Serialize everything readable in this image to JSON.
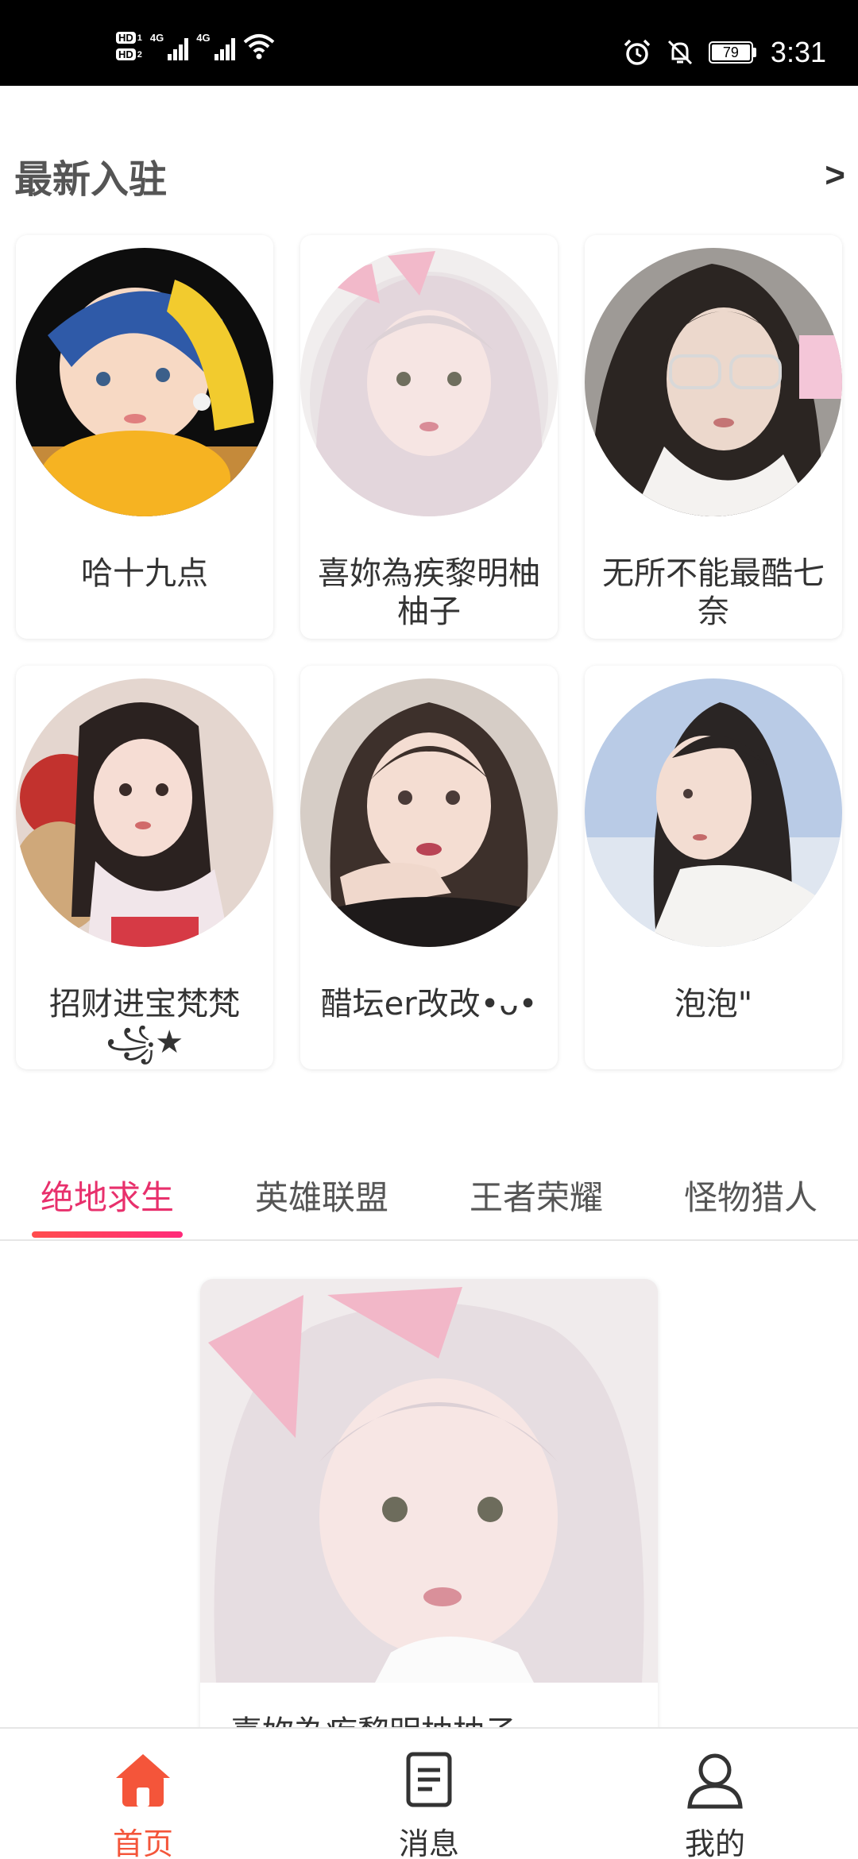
{
  "status_bar": {
    "hd1": "HD",
    "hd1_sub": "1",
    "hd2": "HD",
    "hd2_sub": "2",
    "net1": "4G",
    "net2": "4G",
    "battery": "79",
    "time": "3:31",
    "icons": [
      "signal-icon",
      "wifi-icon",
      "alarm-icon",
      "mute-icon",
      "battery-icon"
    ]
  },
  "section": {
    "title": "最新入驻",
    "more": ">"
  },
  "creators": [
    {
      "name": "哈十九点",
      "avatar": "avatar-icon"
    },
    {
      "name": "喜妳為疾黎明柚柚子",
      "avatar": "avatar-icon"
    },
    {
      "name": "无所不能最酷七奈",
      "avatar": "avatar-icon"
    },
    {
      "name": "招财进宝梵梵꧁★",
      "avatar": "avatar-icon"
    },
    {
      "name": "醋坛er改改•ᴗ•",
      "avatar": "avatar-icon"
    },
    {
      "name": "泡泡\"",
      "avatar": "avatar-icon"
    }
  ],
  "tabs": [
    {
      "label": "绝地求生",
      "active": true
    },
    {
      "label": "英雄联盟",
      "active": false
    },
    {
      "label": "王者荣耀",
      "active": false
    },
    {
      "label": "怪物猎人",
      "active": false
    }
  ],
  "feed": {
    "title": "喜妳為疾黎明柚柚子"
  },
  "bottom_nav": [
    {
      "label": "首页",
      "icon": "home-icon",
      "active": true
    },
    {
      "label": "消息",
      "icon": "message-icon",
      "active": false
    },
    {
      "label": "我的",
      "icon": "profile-icon",
      "active": false
    }
  ],
  "colors": {
    "accent": "#e8306c",
    "nav_active": "#f4553a"
  }
}
